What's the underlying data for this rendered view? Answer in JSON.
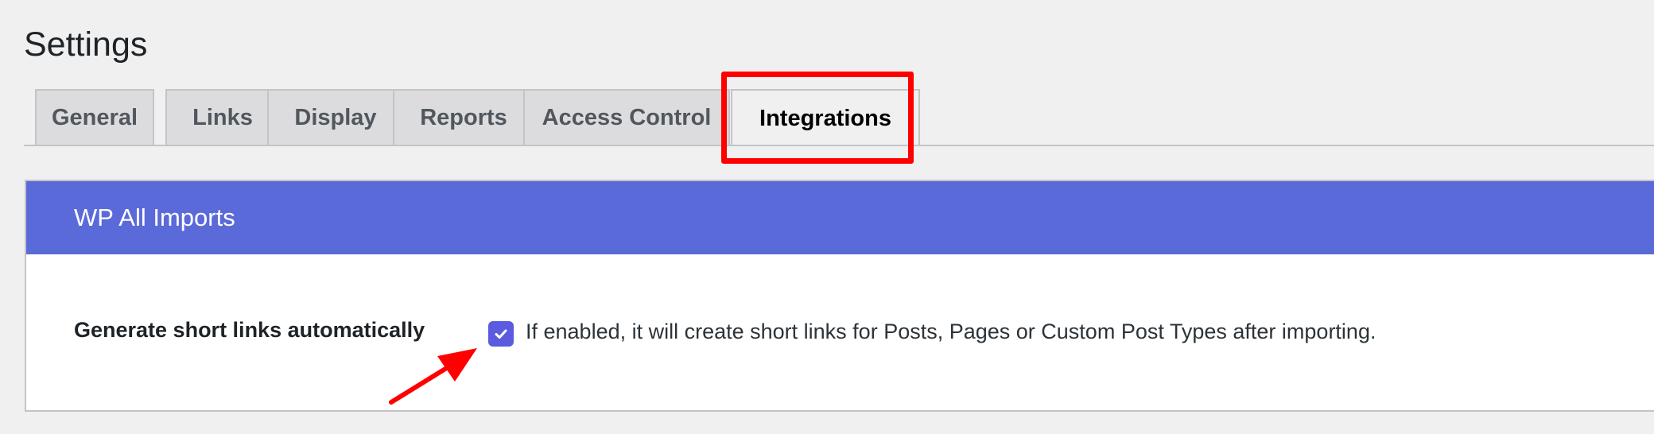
{
  "page": {
    "title": "Settings"
  },
  "tabs": [
    {
      "label": "General",
      "active": false
    },
    {
      "label": "Links",
      "active": false
    },
    {
      "label": "Display",
      "active": false
    },
    {
      "label": "Reports",
      "active": false
    },
    {
      "label": "Access Control",
      "active": false
    },
    {
      "label": "Integrations",
      "active": true
    }
  ],
  "panel": {
    "header": "WP All Imports",
    "setting": {
      "label": "Generate short links automatically",
      "checked": true,
      "description": "If enabled, it will create short links for Posts, Pages or Custom Post Types after importing."
    }
  },
  "colors": {
    "accent": "#5b6ad9",
    "checkbox": "#5b5bdf",
    "highlight": "#ff0000",
    "background": "#f0f0f1"
  },
  "icons": {
    "checkbox_mark": "check-icon",
    "annotation": "arrow-icon"
  }
}
